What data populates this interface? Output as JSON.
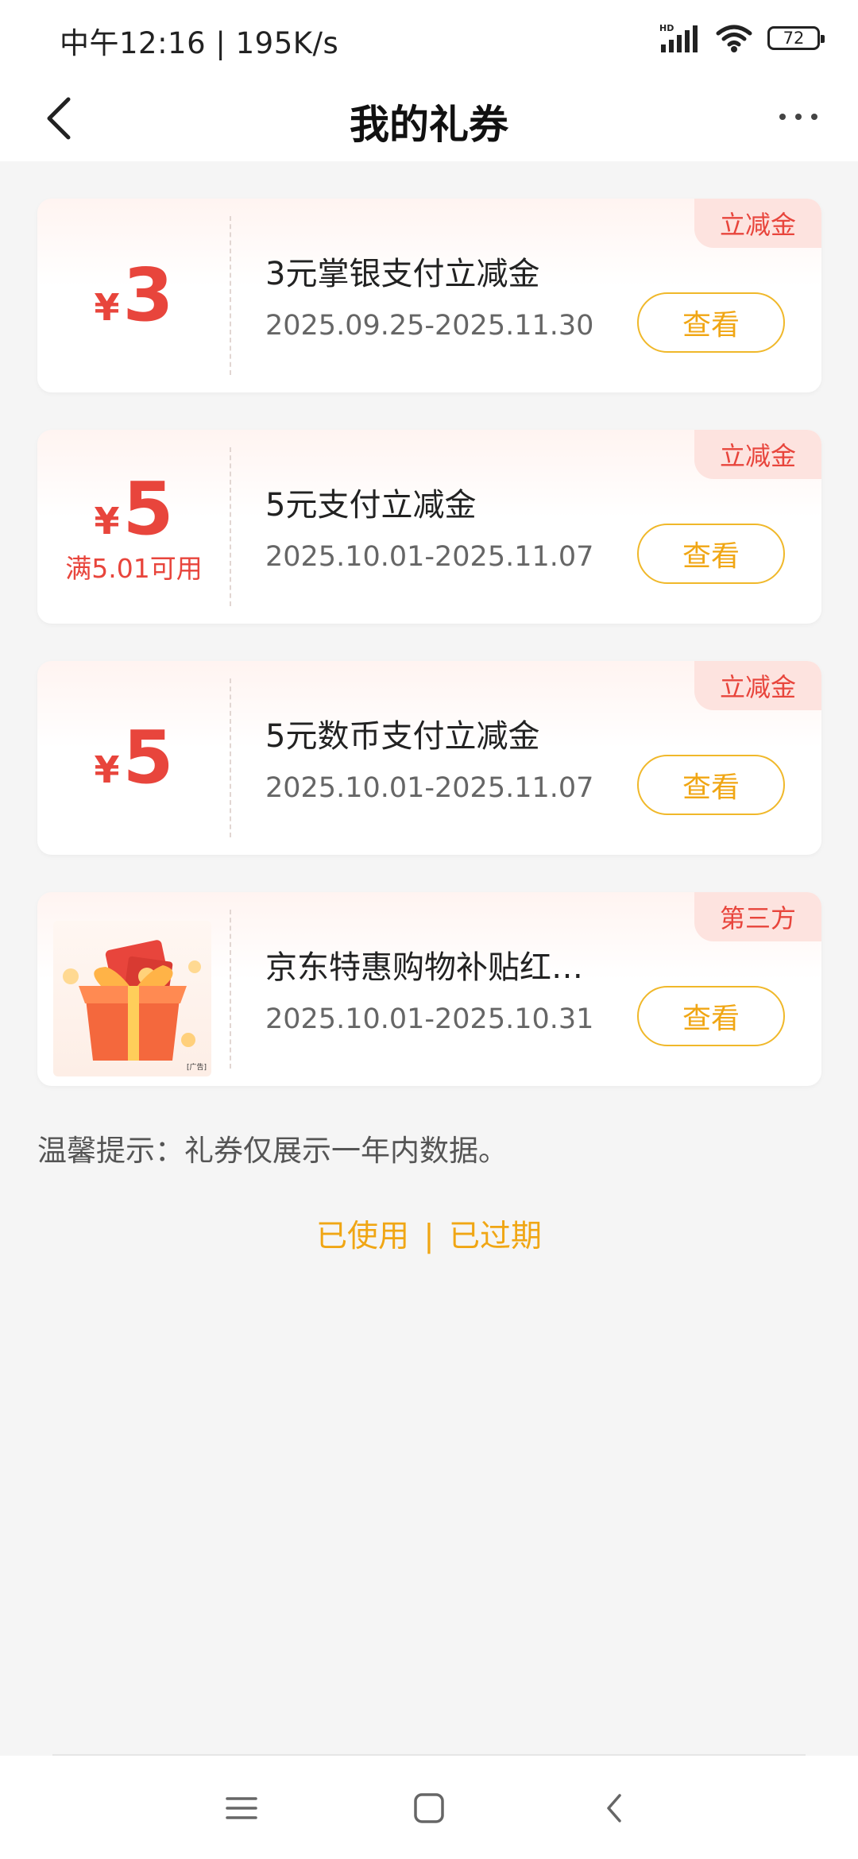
{
  "status_bar": {
    "time": "中午12:16 | 195K/s",
    "network_label": "HD",
    "battery": "72"
  },
  "header": {
    "title": "我的礼券"
  },
  "coupons": [
    {
      "currency": "¥",
      "amount": "3",
      "condition": "",
      "tag": "立减金",
      "title": "3元掌银支付立减金",
      "date_range": "2025.09.25-2025.11.30",
      "button": "查看"
    },
    {
      "currency": "¥",
      "amount": "5",
      "condition": "满5.01可用",
      "tag": "立减金",
      "title": "5元支付立减金",
      "date_range": "2025.10.01-2025.11.07",
      "button": "查看"
    },
    {
      "currency": "¥",
      "amount": "5",
      "condition": "",
      "tag": "立减金",
      "title": "5元数币支付立减金",
      "date_range": "2025.10.01-2025.11.07",
      "button": "查看"
    },
    {
      "image": "gift-box-red-envelope",
      "ad_mark": "[广告]",
      "tag": "第三方",
      "title": "京东特惠购物补贴红…",
      "date_range": "2025.10.01-2025.10.31",
      "button": "查看"
    }
  ],
  "tip": "温馨提示：礼券仅展示一年内数据。",
  "history_links": {
    "used": "已使用",
    "separator": "|",
    "expired": "已过期"
  },
  "colors": {
    "accent_red": "#e8453c",
    "accent_orange": "#f0a614",
    "tag_bg": "#fde3df",
    "page_bg": "#f5f5f5"
  },
  "icons": {
    "back": "chevron-left-icon",
    "more": "more-dots-icon",
    "signal": "signal-icon",
    "wifi": "wifi-icon",
    "battery": "battery-icon",
    "menu": "menu-lines-icon",
    "home": "home-square-icon",
    "back_system": "back-arrow-icon"
  }
}
